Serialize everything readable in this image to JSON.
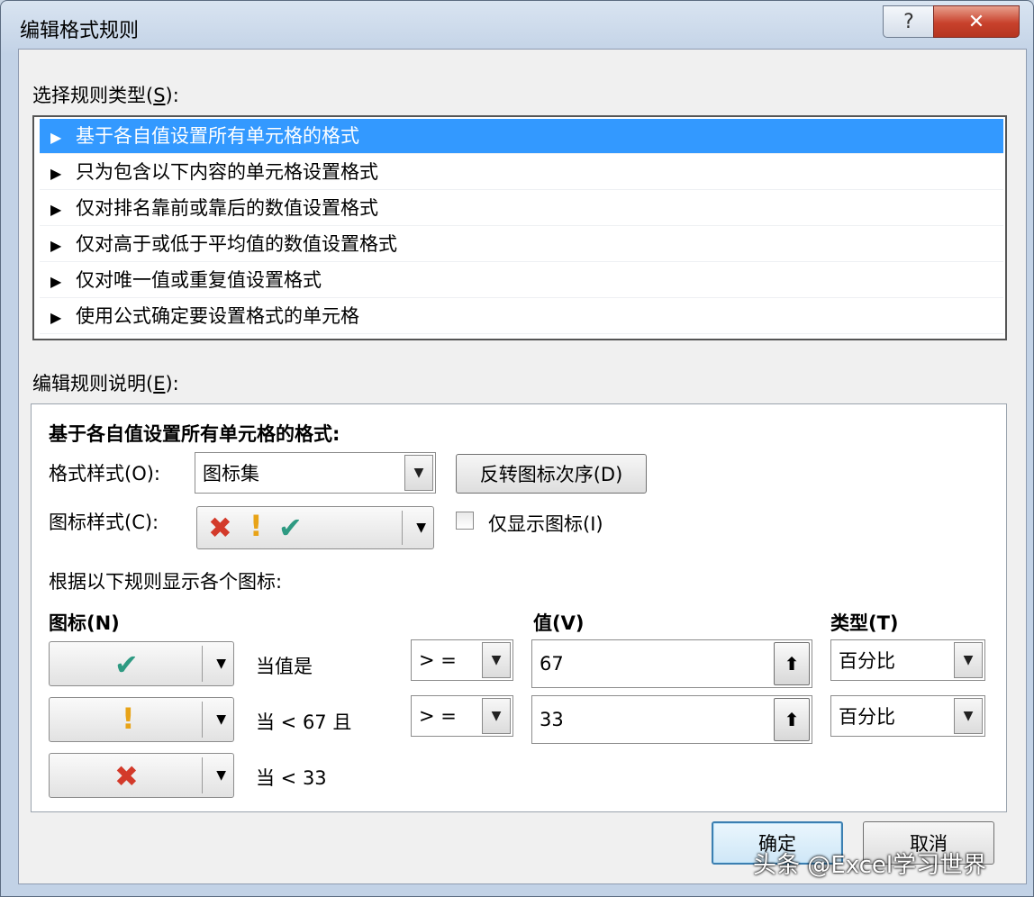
{
  "window": {
    "title": "编辑格式规则",
    "help_glyph": "?",
    "close_glyph": "✕"
  },
  "rule_type": {
    "label": "选择规则类型",
    "label_hotkey": "S",
    "items": [
      {
        "text": "基于各自值设置所有单元格的格式",
        "selected": true
      },
      {
        "text": "只为包含以下内容的单元格设置格式",
        "selected": false
      },
      {
        "text": "仅对排名靠前或靠后的数值设置格式",
        "selected": false
      },
      {
        "text": "仅对高于或低于平均值的数值设置格式",
        "selected": false
      },
      {
        "text": "仅对唯一值或重复值设置格式",
        "selected": false
      },
      {
        "text": "使用公式确定要设置格式的单元格",
        "selected": false
      }
    ]
  },
  "rule_desc": {
    "label": "编辑规则说明",
    "label_hotkey": "E",
    "heading": "基于各自值设置所有单元格的格式:",
    "format_style_label": "格式样式(O):",
    "format_style_value": "图标集",
    "reverse_button": "反转图标次序(D)",
    "icon_style_label": "图标样式(C):",
    "icon_style_icons": [
      "red-x",
      "yellow-exclamation",
      "green-check"
    ],
    "show_icon_only_label": "仅显示图标(I)",
    "show_icon_only_checked": false,
    "rules_caption": "根据以下规则显示各个图标:",
    "col_icon": "图标(N)",
    "col_value": "值(V)",
    "col_type": "类型(T)",
    "rows": [
      {
        "icon": "green-check",
        "condition": "当值是",
        "operator": "> =",
        "value": "67",
        "type": "百分比"
      },
      {
        "icon": "yellow-exclamation",
        "condition": "当 < 67 且",
        "operator": "> =",
        "value": "33",
        "type": "百分比"
      },
      {
        "icon": "red-x",
        "condition": "当 < 33"
      }
    ]
  },
  "footer": {
    "ok": "确定",
    "cancel": "取消"
  },
  "watermark": "头条 @Excel学习世界",
  "colors": {
    "selection": "#3399ff",
    "check": "#2e9a82",
    "exclamation": "#e8a317",
    "cross": "#d33a2a"
  }
}
